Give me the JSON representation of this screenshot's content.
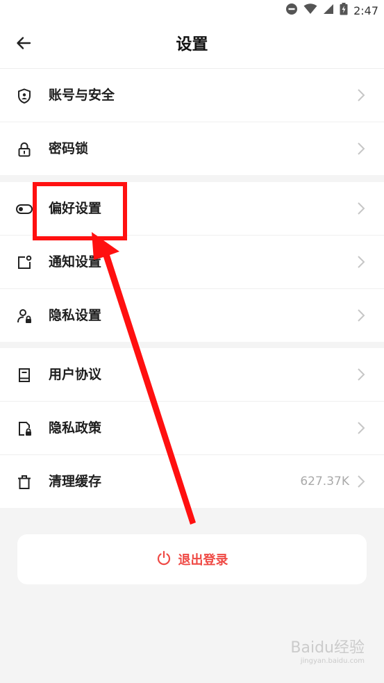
{
  "status_bar": {
    "time": "2:47"
  },
  "header": {
    "title": "设置"
  },
  "groups": [
    {
      "items": [
        {
          "label": "账号与安全",
          "icon": "account-shield-icon"
        },
        {
          "label": "密码锁",
          "icon": "lock-icon"
        }
      ]
    },
    {
      "items": [
        {
          "label": "偏好设置",
          "icon": "toggle-icon"
        },
        {
          "label": "通知设置",
          "icon": "notification-icon"
        },
        {
          "label": "隐私设置",
          "icon": "user-lock-icon"
        }
      ]
    },
    {
      "items": [
        {
          "label": "用户协议",
          "icon": "book-icon"
        },
        {
          "label": "隐私政策",
          "icon": "document-lock-icon"
        },
        {
          "label": "清理缓存",
          "icon": "trash-icon",
          "value": "627.37K"
        }
      ]
    }
  ],
  "logout": {
    "label": "退出登录"
  },
  "watermark": {
    "text": "Baidu经验",
    "sub": "jingyan.baidu.com"
  },
  "colors": {
    "accent": "#ef4a45",
    "annotation": "#ff1010"
  }
}
